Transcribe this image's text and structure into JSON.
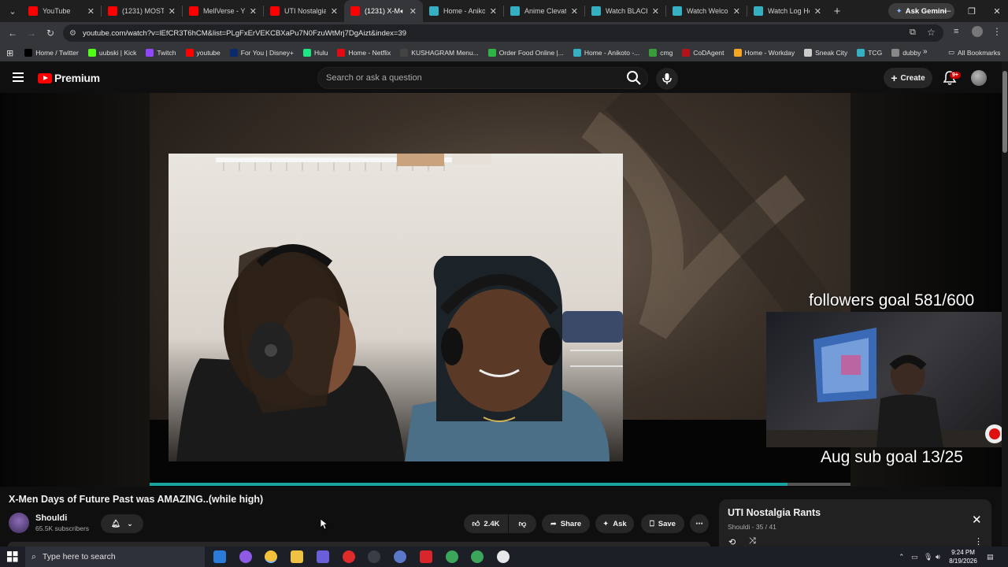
{
  "browser": {
    "tabs": [
      {
        "title": "YouTube",
        "fav": "#ff0000",
        "active": false
      },
      {
        "title": "(1231) MOST D",
        "fav": "#ff0000",
        "active": false
      },
      {
        "title": "MellVerse - Yo",
        "fav": "#ff0000",
        "active": false
      },
      {
        "title": "UTI Nostalgia R",
        "fav": "#ff0000",
        "active": false
      },
      {
        "title": "(1231) X-M",
        "fav": "#ff0000",
        "active": true
      },
      {
        "title": "Home - Aniko",
        "fav": "#35b0c2",
        "active": false
      },
      {
        "title": "Anime Clevate",
        "fav": "#35b0c2",
        "active": false
      },
      {
        "title": "Watch BLACK T",
        "fav": "#35b0c2",
        "active": false
      },
      {
        "title": "Watch Welcom",
        "fav": "#35b0c2",
        "active": false
      },
      {
        "title": "Watch Log Ho",
        "fav": "#35b0c2",
        "active": false
      }
    ],
    "ask_gemini": "Ask Gemini",
    "url": "youtube.com/watch?v=lEfCR3T6hCM&list=PLgFxErVEKCBXaPu7N0FzuWtMrj7DgAizt&index=39",
    "bookmarks": [
      {
        "label": "Home / Twitter",
        "color": "#000000"
      },
      {
        "label": "uubski | Kick",
        "color": "#53fc18"
      },
      {
        "label": "Twitch",
        "color": "#9146ff"
      },
      {
        "label": "youtube",
        "color": "#ff0000"
      },
      {
        "label": "For You | Disney+",
        "color": "#0a2a6b"
      },
      {
        "label": "Hulu",
        "color": "#1ce783"
      },
      {
        "label": "Home - Netflix",
        "color": "#e50914"
      },
      {
        "label": "KUSHAGRAM Menu...",
        "color": "#444444"
      },
      {
        "label": "Order Food Online |...",
        "color": "#2fb344"
      },
      {
        "label": "Home - Anikoto -...",
        "color": "#35b0c2"
      },
      {
        "label": "cmg",
        "color": "#3a9b3a"
      },
      {
        "label": "CoDAgent",
        "color": "#b3141c"
      },
      {
        "label": "Home - Workday",
        "color": "#f5a623"
      },
      {
        "label": "Sneak City",
        "color": "#cccccc"
      },
      {
        "label": "TCG",
        "color": "#35b0c2"
      },
      {
        "label": "dubby",
        "color": "#888888"
      }
    ],
    "all_bookmarks": "All Bookmarks"
  },
  "youtube": {
    "logo_text": "Premium",
    "search_placeholder": "Search or ask a question",
    "create_label": "Create",
    "notif_count": "9+",
    "video": {
      "overlay_top": "followers goal 581/600",
      "overlay_bottom": "Aug sub goal 13/25",
      "progress": 0.91
    },
    "title": "X-Men Days of Future Past was AMAZING..(while high)",
    "channel": "Shouldi",
    "subscribers": "65.5K subscribers",
    "likes": "2.4K",
    "share_label": "Share",
    "ask_label": "Ask",
    "save_label": "Save",
    "playlist": {
      "title": "UTI Nostalgia Rants",
      "subtitle": "Shouldi - 35 / 41"
    }
  },
  "taskbar": {
    "search_placeholder": "Type here to search",
    "time": "9:24 PM",
    "date": "8/19/2026"
  }
}
